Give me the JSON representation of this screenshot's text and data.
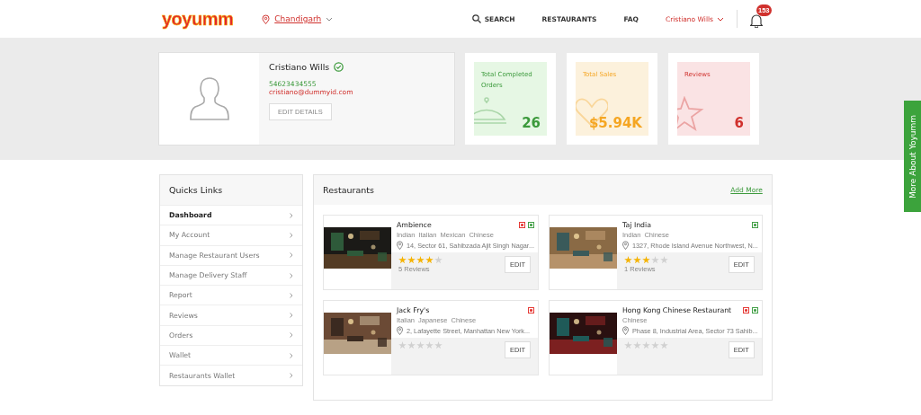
{
  "header": {
    "logo": "yoyumm",
    "location": "Chandigarh",
    "nav": [
      {
        "label": "SEARCH",
        "kind": "search"
      },
      {
        "label": "RESTAURANTS",
        "kind": "link"
      },
      {
        "label": "FAQ",
        "kind": "link"
      }
    ],
    "user": "Cristiano Wills",
    "notifications": "153"
  },
  "profile": {
    "name": "Cristiano Wills",
    "verified": true,
    "phone": "54623434555",
    "email": "cristiano@dummyid.com",
    "edit_button": "EDIT DETAILS"
  },
  "stats": [
    {
      "kind": "orders",
      "label": "Total Completed Orders",
      "value": "26",
      "color": "#3c9a3c"
    },
    {
      "kind": "sales",
      "label": "Total Sales",
      "value": "$5.94K",
      "color": "#f5a623"
    },
    {
      "kind": "reviews",
      "label": "Reviews",
      "value": "6",
      "color": "#d0312d"
    }
  ],
  "quick_links": {
    "title": "Quicks Links",
    "items": [
      {
        "label": "Dashboard",
        "selected": true
      },
      {
        "label": "My Account",
        "selected": false
      },
      {
        "label": "Manage Restaurant Users",
        "selected": false
      },
      {
        "label": "Manage Delivery Staff",
        "selected": false
      },
      {
        "label": "Report",
        "selected": false
      },
      {
        "label": "Reviews",
        "selected": false
      },
      {
        "label": "Orders",
        "selected": false
      },
      {
        "label": "Wallet",
        "selected": false
      },
      {
        "label": "Restaurants Wallet",
        "selected": false
      }
    ]
  },
  "restaurants": {
    "title": "Restaurants",
    "add_more": "Add More",
    "items": [
      {
        "name": "Ambience",
        "cuisines": [
          "Indian",
          "Italian",
          "Mexican",
          "Chinese"
        ],
        "address": "14, Sector 61, Sahibzada Ajit Singh Nagar...",
        "stars": 4,
        "reviews": "5 Reviews",
        "diet_marks": [
          {
            "color": "#e53935"
          },
          {
            "color": "#43a047"
          }
        ],
        "edit": "EDIT"
      },
      {
        "name": "Taj India",
        "cuisines": [
          "Indian",
          "Chinese"
        ],
        "address": "1327, Rhode Island Avenue Northwest, N...",
        "stars": 3,
        "reviews": "1 Reviews",
        "diet_marks": [
          {
            "color": "#43a047"
          }
        ],
        "edit": "EDIT"
      },
      {
        "name": "Jack Fry's",
        "cuisines": [
          "Italian",
          "Japanese",
          "Chinese"
        ],
        "address": "2, Lafayette Street, Manhattan New York...",
        "stars": 0,
        "diet_marks": [
          {
            "color": "#e53935"
          }
        ],
        "edit": "EDIT"
      },
      {
        "name": "Hong Kong Chinese Restaurant",
        "cuisines": [
          "Chinese"
        ],
        "address": "Phase 8, Industrial Area, Sector 73 Sahib...",
        "stars": 0,
        "diet_marks": [
          {
            "color": "#e53935"
          },
          {
            "color": "#43a047"
          }
        ],
        "edit": "EDIT"
      }
    ]
  },
  "side_tab": "More About Yoyumm"
}
